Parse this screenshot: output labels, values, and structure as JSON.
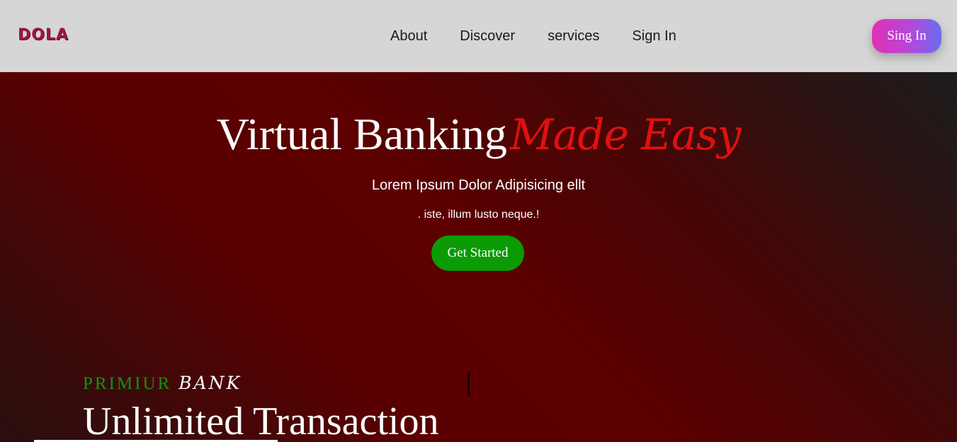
{
  "header": {
    "logo": "DOLA",
    "nav": [
      {
        "label": "About"
      },
      {
        "label": "Discover"
      },
      {
        "label": "services"
      },
      {
        "label": "Sign In"
      }
    ],
    "signin_button": "Sing In"
  },
  "hero": {
    "title_main": "Virtual Banking",
    "title_script": "Made Easy",
    "subtitle": "Lorem Ipsum Dolor Adipisicing ellt",
    "subtext": ". iste, illum lusto neque.!",
    "cta_button": "Get Started"
  },
  "section": {
    "label_primary": "PRIMIUR",
    "label_secondary": "BANK",
    "heading": "Unlimited Transaction"
  },
  "colors": {
    "header_bg": "#d6d6d6",
    "hero_bg": "#5a0000",
    "accent_red": "#e01010",
    "cta_green": "#0a9b05",
    "label_green": "#149214",
    "logo": "#9c1547"
  }
}
